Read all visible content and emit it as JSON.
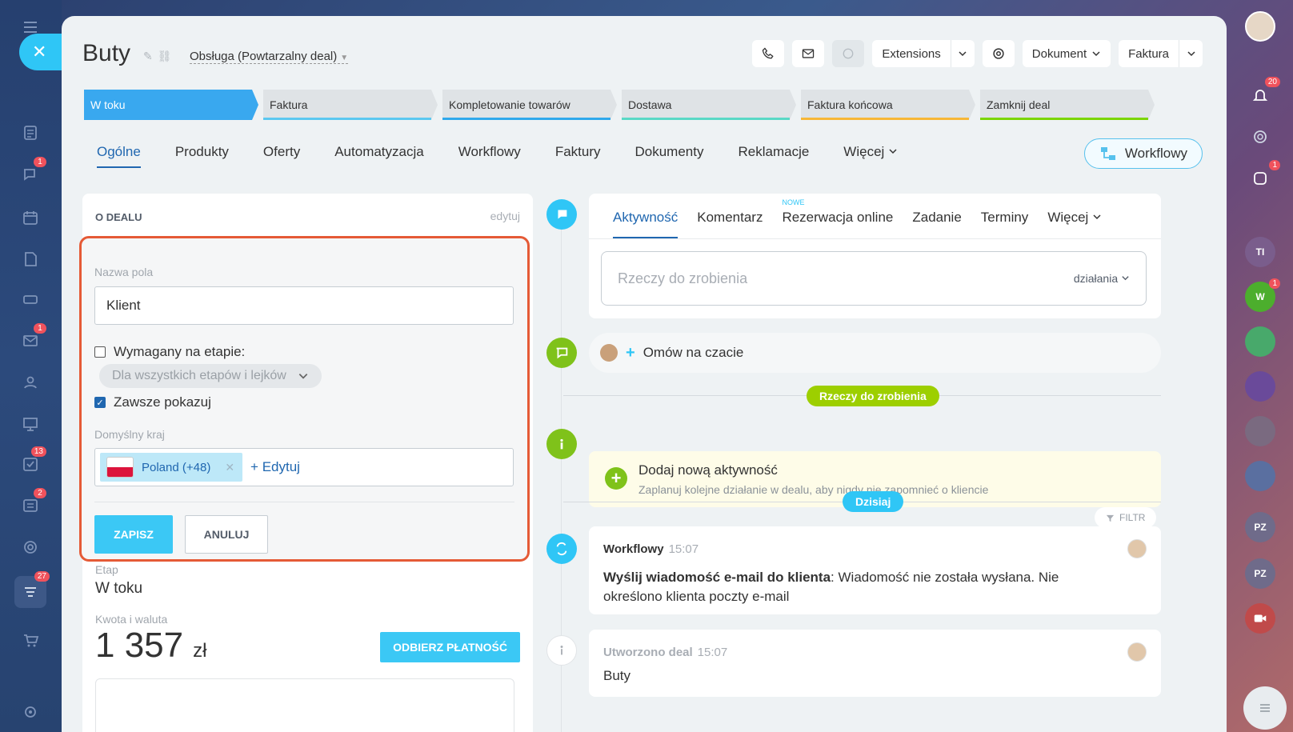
{
  "sidebar": {
    "badges": {
      "chat": "1",
      "mail": "1",
      "tasks": "13",
      "reports": "2",
      "crm": "27"
    }
  },
  "right_bar": {
    "notifications_badge": "20",
    "updates_badge": "1",
    "avatars": [
      {
        "initials": "TI",
        "color": "#7a5d8c"
      },
      {
        "initials": "W",
        "color": "#4cae2d",
        "badge": "1"
      },
      {
        "initials": "PZ",
        "color": "#6f6b8a"
      },
      {
        "initials": "PZ",
        "color": "#6f6b8a"
      }
    ]
  },
  "header": {
    "title": "Buty",
    "pipeline": "Obsługa (Powtarzalny deal)",
    "extensions_label": "Extensions",
    "document_label": "Dokument",
    "invoice_label": "Faktura"
  },
  "stages": [
    {
      "label": "W toku",
      "color": "#39a8ef",
      "active": true
    },
    {
      "label": "Faktura",
      "color": "#5bc8f0"
    },
    {
      "label": "Kompletowanie towarów",
      "color": "#2fa9ec"
    },
    {
      "label": "Dostawa",
      "color": "#5ad9c6"
    },
    {
      "label": "Faktura końcowa",
      "color": "#f7b737"
    },
    {
      "label": "Zamknij deal",
      "color": "#7bd500"
    }
  ],
  "tabs": [
    "Ogólne",
    "Produkty",
    "Oferty",
    "Automatyzacja",
    "Workflowy",
    "Faktury",
    "Dokumenty",
    "Reklamacje",
    "Więcej"
  ],
  "workflow_button": "Workflowy",
  "deal_card": {
    "title": "O DEALU",
    "edit": "edytuj",
    "field_name_label": "Nazwa pola",
    "field_name_value": "Klient",
    "required_label": "Wymagany na etapie:",
    "stage_select": "Dla wszystkich etapów i lejków",
    "always_show_label": "Zawsze pokazuj",
    "default_country_label": "Domyślny kraj",
    "country_tag": "Poland (+48)",
    "edit_link": "+ Edytuj",
    "save": "ZAPISZ",
    "cancel": "ANULUJ",
    "stage_label": "Etap",
    "stage_value": "W toku",
    "amount_label": "Kwota i waluta",
    "amount_value": "1 357",
    "currency": "zł",
    "pay_button": "ODBIERZ PŁATNOŚĆ"
  },
  "activity": {
    "tabs": [
      "Aktywność",
      "Komentarz",
      "Rezerwacja online",
      "Zadanie",
      "Terminy",
      "Więcej"
    ],
    "nowe": "NOWE",
    "todo_placeholder": "Rzeczy do zrobienia",
    "todo_actions": "działania",
    "chat_label": "Omów na czacie",
    "todo_pill": "Rzeczy do zrobienia",
    "add_title": "Dodaj nową aktywność",
    "add_sub": "Zaplanuj kolejne działanie w dealu, aby nigdy nie zapomnieć o kliencie",
    "today_pill": "Dzisiaj",
    "filter": "FILTR",
    "event1_title": "Workflowy",
    "event1_time": "15:07",
    "event1_bold": "Wyślij wiadomość e-mail do klienta",
    "event1_text": ": Wiadomość nie została wysłana. Nie określono klienta poczty e-mail",
    "event2_title": "Utworzono deal",
    "event2_time": "15:07",
    "event2_text": "Buty"
  }
}
